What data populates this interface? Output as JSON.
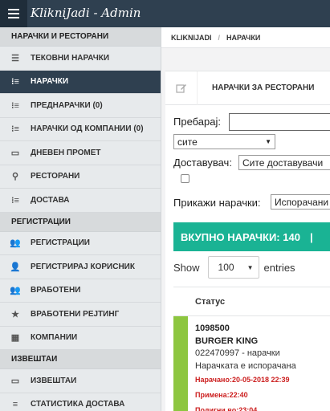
{
  "header": {
    "brand": "KlikniJadi - Admin"
  },
  "breadcrumb": {
    "home": "KLIKNIJADI",
    "sep": "/",
    "current": "НАРАЧКИ"
  },
  "sidebar": {
    "sections": [
      {
        "title": "НАРАЧКИ И РЕСТОРАНИ",
        "items": [
          {
            "label": "ТЕКОВНИ НАРАЧКИ",
            "icon": "list-icon"
          },
          {
            "label": "НАРАЧКИ",
            "icon": "list-ordered-icon",
            "active": true
          },
          {
            "label": "ПРЕДНАРАЧКИ (0)",
            "icon": "list-ordered-icon"
          },
          {
            "label": "НАРАЧКИ ОД КОМПАНИИ (0)",
            "icon": "list-ordered-icon"
          },
          {
            "label": "ДНЕВЕН ПРОМЕТ",
            "icon": "money-icon"
          },
          {
            "label": "РЕСТОРАНИ",
            "icon": "map-marker-icon"
          },
          {
            "label": "ДОСТАВА",
            "icon": "list-ordered-icon"
          }
        ]
      },
      {
        "title": "РЕГИСТРАЦИИ",
        "items": [
          {
            "label": "РЕГИСТРАЦИИ",
            "icon": "users-icon"
          },
          {
            "label": "РЕГИСТРИРАЈ КОРИСНИК",
            "icon": "user-icon"
          },
          {
            "label": "ВРАБОТЕНИ",
            "icon": "users-icon"
          },
          {
            "label": "ВРАБОТЕНИ РЕЈТИНГ",
            "icon": "star-icon"
          },
          {
            "label": "КОМПАНИИ",
            "icon": "building-icon"
          }
        ]
      },
      {
        "title": "ИЗВЕШТАИ",
        "items": [
          {
            "label": "ИЗВЕШТАИ",
            "icon": "money-icon"
          },
          {
            "label": "СТАТИСТИКА ДОСТАВА",
            "icon": "bars-icon"
          }
        ]
      }
    ]
  },
  "panel": {
    "title": "НАРАЧКИ ЗА РЕСТОРАНИ",
    "icon": "edit-icon"
  },
  "filters": {
    "search_label": "Пребарај:",
    "search_value": "",
    "city_select": "сите",
    "courier_label": "Доставувач:",
    "courier_select": "Сите доставувачи",
    "show_orders_label": "Прикажи нарачки:",
    "show_orders_select": "Испорачани"
  },
  "total": {
    "text": "ВКУПНО НАРАЧКИ: 140",
    "sep": "|"
  },
  "entries": {
    "show": "Show",
    "value": "100",
    "suffix": "entries"
  },
  "table": {
    "header": "Статус",
    "rows": [
      {
        "id": "1098500",
        "restaurant": "BURGER KING",
        "phone": "022470997 - нарачки",
        "status": "Нарачката е испорачана",
        "ordered": "Нарачано:20-05-2018 22:39",
        "received": "Примена:22:40",
        "picked": "Подигни во:23:04",
        "status_color": "#8dc63f"
      }
    ]
  },
  "colors": {
    "sidebar_dark": "#2f4050",
    "accent": "#1ab394",
    "alert": "#cc1f1f"
  }
}
